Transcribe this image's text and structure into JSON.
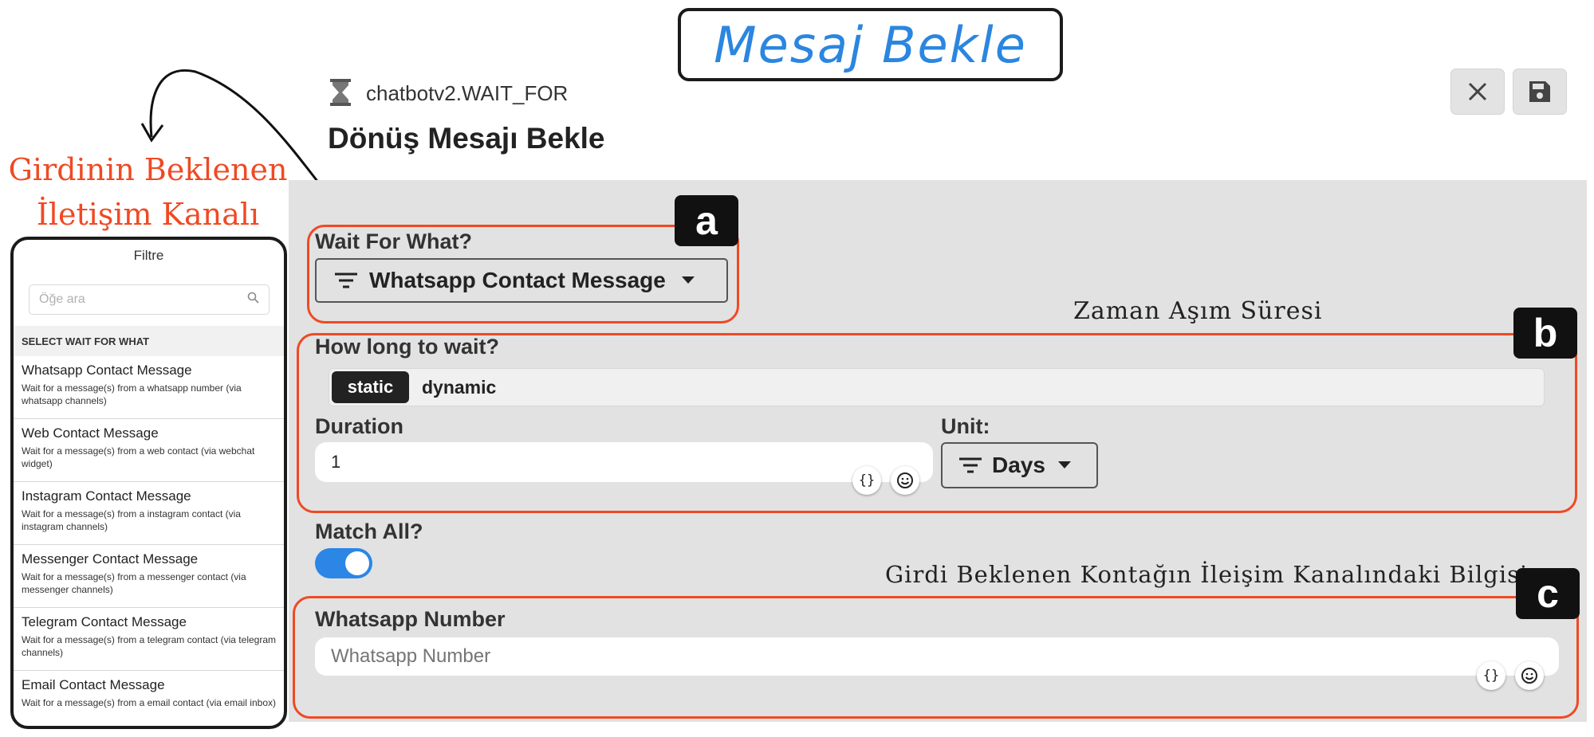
{
  "banner": {
    "title": "Mesaj Bekle"
  },
  "annotations": {
    "left": [
      "Girdinin Beklenen",
      "İletişim Kanalı"
    ],
    "timeout": "Zaman Aşım Süresi",
    "contact_info": "Girdi Beklenen Kontağın İleişim Kanalındaki Bilgisi",
    "badges": {
      "a": "a",
      "b": "b",
      "c": "c"
    },
    "color": "#ef4a24"
  },
  "header": {
    "node_id": "chatbotv2.WAIT_FOR",
    "title": "Dönüş Mesajı Bekle",
    "icons": {
      "node": "hourglass-icon",
      "close": "close-icon",
      "save": "save-icon"
    }
  },
  "form": {
    "wait_for": {
      "label": "Wait For What?",
      "selected": "Whatsapp Contact Message"
    },
    "how_long": {
      "label": "How long to wait?",
      "modes": [
        "static",
        "dynamic"
      ],
      "active_mode": "static"
    },
    "duration": {
      "label": "Duration",
      "value": "1"
    },
    "unit": {
      "label": "Unit:",
      "selected": "Days"
    },
    "match_all": {
      "label": "Match All?",
      "enabled": true
    },
    "whatsapp_number": {
      "label": "Whatsapp Number",
      "placeholder": "Whatsapp Number"
    },
    "field_buttons": {
      "variable": "{}",
      "emoji": "emoji-icon"
    },
    "accent": "#2b86e6"
  },
  "filter": {
    "title": "Filtre",
    "search_placeholder": "Öğe ara",
    "heading": "SELECT WAIT FOR WHAT",
    "items": [
      {
        "title": "Whatsapp Contact Message",
        "desc": "Wait for a message(s) from a whatsapp number (via whatsapp channels)"
      },
      {
        "title": "Web Contact Message",
        "desc": "Wait for a message(s) from a web contact (via webchat widget)"
      },
      {
        "title": "Instagram Contact Message",
        "desc": "Wait for a message(s) from a instagram contact (via instagram channels)"
      },
      {
        "title": "Messenger Contact Message",
        "desc": "Wait for a message(s) from a messenger contact (via messenger channels)"
      },
      {
        "title": "Telegram Contact Message",
        "desc": "Wait for a message(s) from a telegram contact (via telegram channels)"
      },
      {
        "title": "Email Contact Message",
        "desc": "Wait for a message(s) from a email contact (via email inbox)"
      }
    ]
  }
}
